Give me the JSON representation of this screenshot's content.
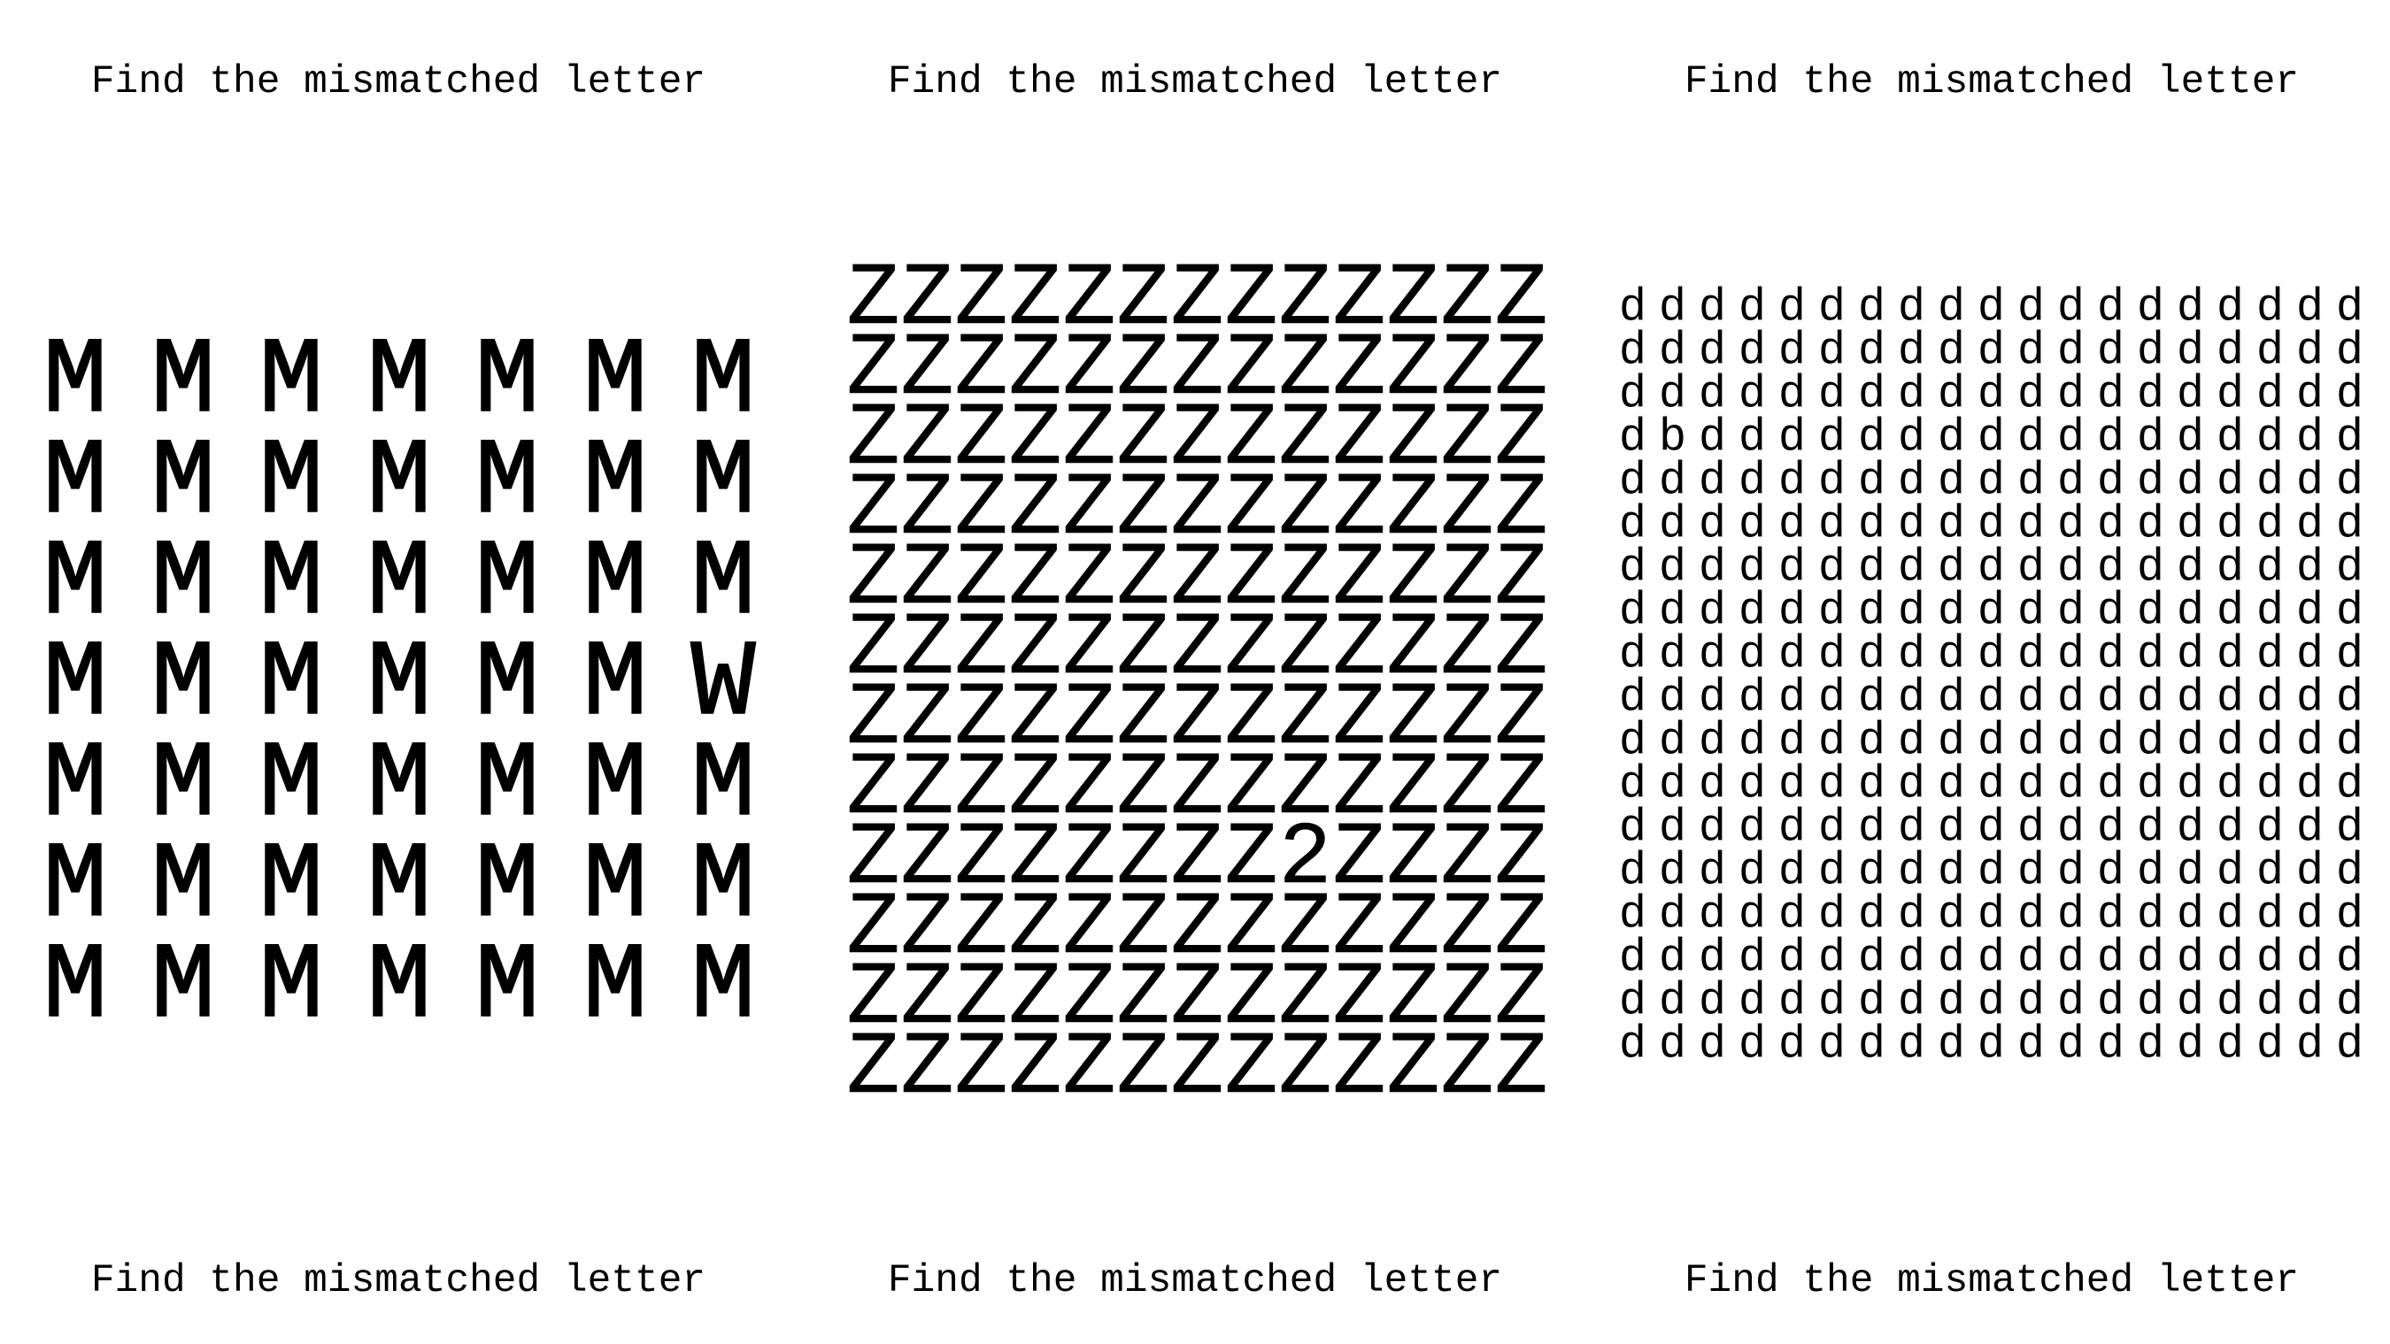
{
  "puzzles": [
    {
      "title_top": "Find the mismatched letter",
      "title_bottom": "Find the mismatched letter",
      "base_char": "M",
      "odd_char": "W",
      "rows": 7,
      "cols": 7,
      "odd_position": {
        "row": 4,
        "col": 7
      }
    },
    {
      "title_top": "Find the mismatched letter",
      "title_bottom": "Find the mismatched letter",
      "base_char": "Z",
      "odd_char": "2",
      "rows": 12,
      "cols": 13,
      "odd_position": {
        "row": 9,
        "col": 9
      }
    },
    {
      "title_top": "Find the mismatched letter",
      "title_bottom": "Find the mismatched letter",
      "base_char": "d",
      "odd_char": "b",
      "rows": 18,
      "cols": 19,
      "odd_position": {
        "row": 4,
        "col": 2
      }
    }
  ]
}
